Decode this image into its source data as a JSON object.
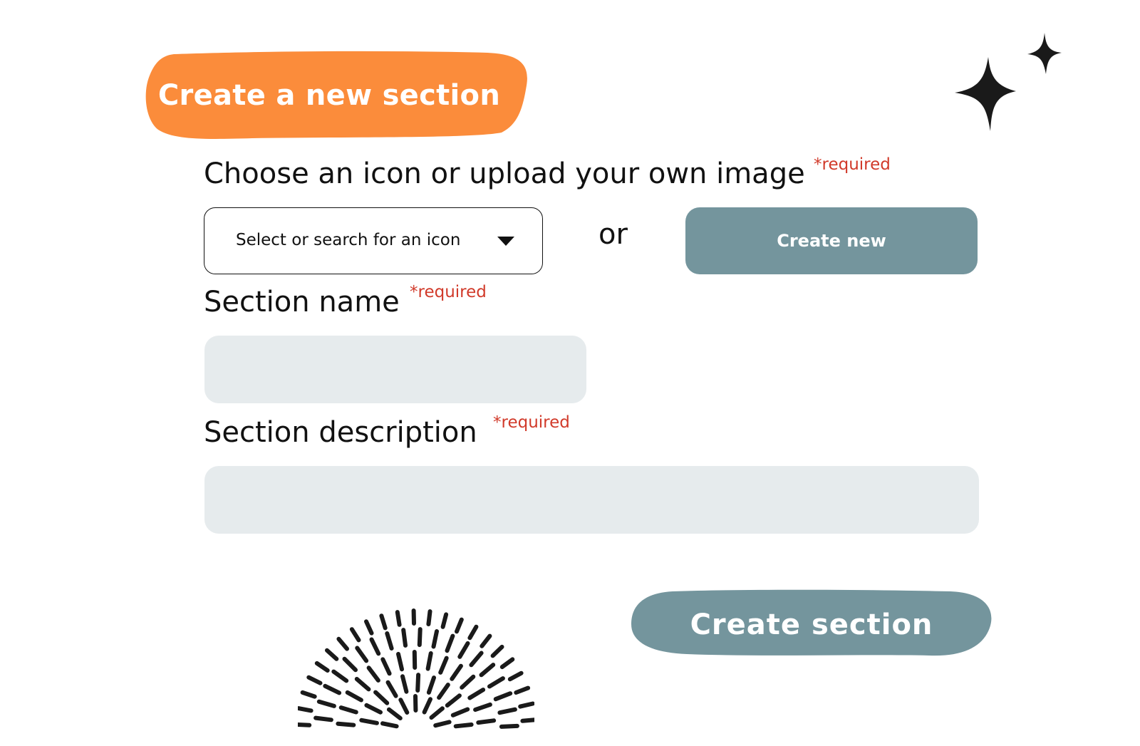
{
  "title": "Create a new section",
  "icon_field": {
    "label": "Choose an icon or upload your own image",
    "required": "*required",
    "select_text": "Select or search for an icon",
    "or_text": "or",
    "create_new_label": "Create new"
  },
  "name_field": {
    "label": "Section name",
    "required": "*required",
    "value": ""
  },
  "description_field": {
    "label": "Section description",
    "required": "*required",
    "value": ""
  },
  "submit": {
    "label": "Create section"
  },
  "colors": {
    "title_bg": "#fb8c3b",
    "button_bg": "#74959d",
    "required_text": "#d13a2a",
    "input_bg": "#e6ebed",
    "ink": "#111111"
  },
  "icons": [
    "chevron-down-icon",
    "sparkle-icon",
    "radial-dash-decoration"
  ]
}
